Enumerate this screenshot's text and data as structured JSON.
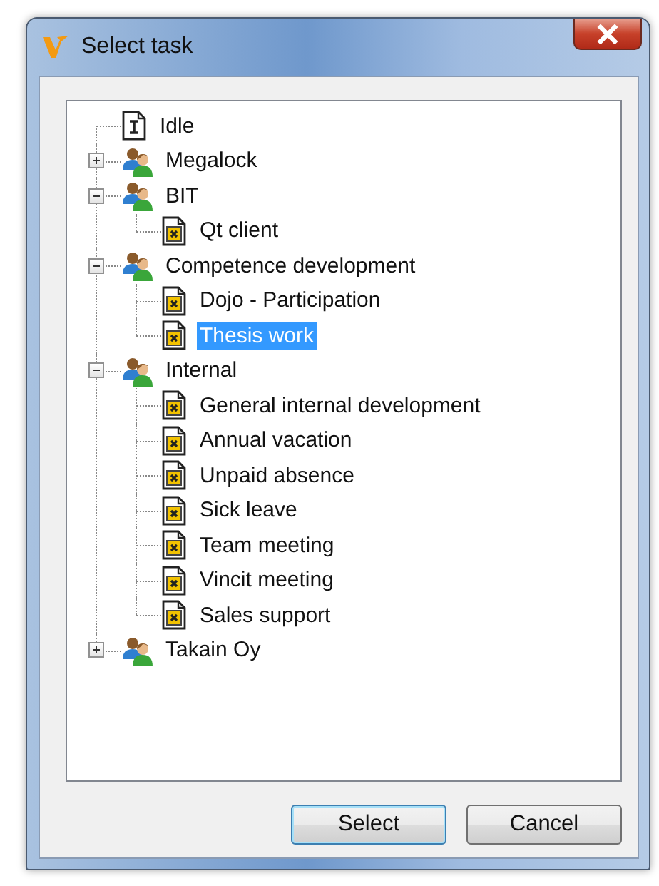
{
  "window": {
    "title": "Select task"
  },
  "tree": [
    {
      "kind": "idle",
      "label": "Idle",
      "selected": false
    },
    {
      "kind": "group",
      "label": "Megalock",
      "expanded": false,
      "selected": false
    },
    {
      "kind": "group",
      "label": "BIT",
      "expanded": true,
      "selected": false,
      "children": [
        {
          "kind": "task",
          "label": "Qt client",
          "selected": false
        }
      ]
    },
    {
      "kind": "group",
      "label": "Competence development",
      "expanded": true,
      "selected": false,
      "children": [
        {
          "kind": "task",
          "label": "Dojo - Participation",
          "selected": false
        },
        {
          "kind": "task",
          "label": "Thesis work",
          "selected": true
        }
      ]
    },
    {
      "kind": "group",
      "label": "Internal",
      "expanded": true,
      "selected": false,
      "children": [
        {
          "kind": "task",
          "label": "General internal development",
          "selected": false
        },
        {
          "kind": "task",
          "label": "Annual vacation",
          "selected": false
        },
        {
          "kind": "task",
          "label": "Unpaid absence",
          "selected": false
        },
        {
          "kind": "task",
          "label": "Sick leave",
          "selected": false
        },
        {
          "kind": "task",
          "label": "Team meeting",
          "selected": false
        },
        {
          "kind": "task",
          "label": "Vincit meeting",
          "selected": false
        },
        {
          "kind": "task",
          "label": "Sales support",
          "selected": false
        }
      ]
    },
    {
      "kind": "group",
      "label": "Takain Oy",
      "expanded": false,
      "selected": false
    }
  ],
  "buttons": [
    {
      "label": "Select",
      "kind": "default"
    },
    {
      "label": "Cancel",
      "kind": "normal"
    }
  ]
}
